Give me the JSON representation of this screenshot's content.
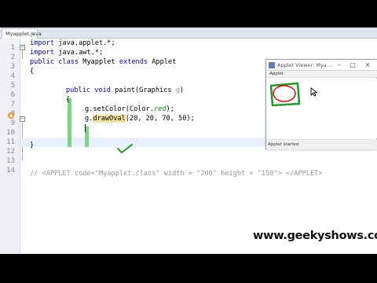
{
  "editor": {
    "tab_label": "Myapplet.java",
    "tab_close": "×",
    "line_numbers": [
      "1",
      "2",
      "3",
      "4",
      "5",
      "6",
      "7",
      "8",
      "9",
      "10",
      "11",
      "12",
      "13",
      "14"
    ],
    "lines": {
      "l1": {
        "kw": "import",
        "rest": " java.applet.*;"
      },
      "l2": {
        "kw": "import",
        "rest": " java.awt.*;"
      },
      "l3": {
        "kw1": "public class",
        "name": " Myapplet ",
        "kw2": "extends",
        "rest": " Applet"
      },
      "l4": {
        "text": "{"
      },
      "l6": {
        "kw": "public void",
        "mth": " paint",
        "open": "(Graphics ",
        "param": "g",
        "close": ")"
      },
      "l7": {
        "text": "{"
      },
      "l8": {
        "obj": "g.",
        "mth": "setColor",
        "open": "(Color.",
        "field": "red",
        "close": ");"
      },
      "l9": {
        "obj": "g.",
        "mth": "drawOval",
        "rest": "(20, 20, 70, 50);"
      },
      "l11": {
        "text": "}"
      },
      "l13": {
        "text": "// <APPLET code=\"Myapplet.class\" width = \"200\" height = \"150\"> </APPLET>"
      }
    },
    "fold_symbol": "−",
    "override_marker_icon": "override-icon"
  },
  "applet_viewer": {
    "title": "Applet Viewer: Mya...",
    "menu_label": "Applet",
    "status": "Applet started.",
    "minimize": "–",
    "maximize": "□",
    "close": "×",
    "drawing": {
      "shape": "oval",
      "color": "#ff0000",
      "annotation_color": "#1a9e2a"
    }
  },
  "watermark": "www.geekyshows.com",
  "colors": {
    "keyword": "#0000e6",
    "field": "#009900",
    "comment": "#969696",
    "highlight": "#f3e5a0",
    "scope_bar": "#7cd67c"
  }
}
